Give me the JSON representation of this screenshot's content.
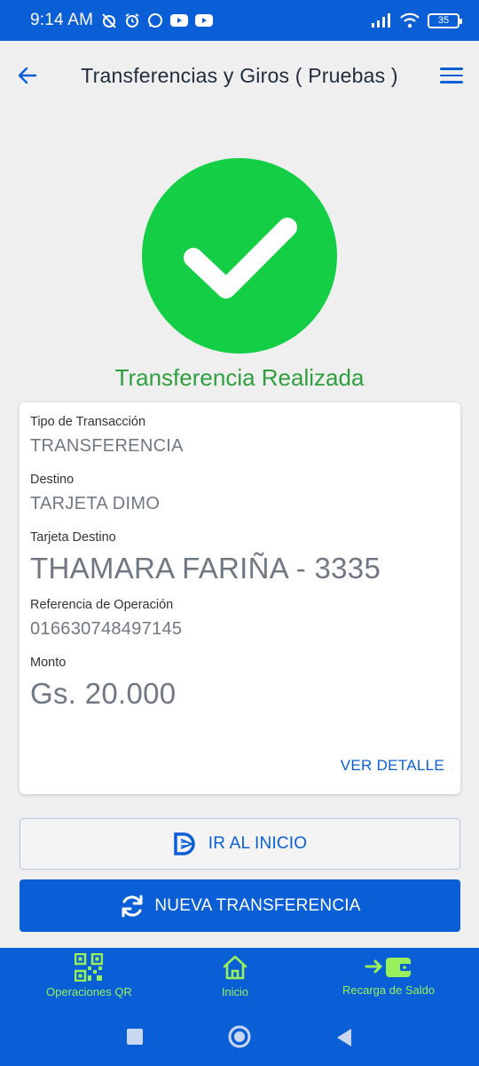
{
  "status_bar": {
    "time": "9:14 AM",
    "battery": "35"
  },
  "header": {
    "title": "Transferencias y Giros ( Pruebas )"
  },
  "result": {
    "title": "Transferencia Realizada"
  },
  "details": {
    "tipo_label": "Tipo de Transacción",
    "tipo_value": "TRANSFERENCIA",
    "destino_label": "Destino",
    "destino_value": "TARJETA DIMO",
    "tarjeta_label": "Tarjeta Destino",
    "tarjeta_value": "THAMARA FARIÑA - 3335",
    "referencia_label": "Referencia de Operación",
    "referencia_value": "016630748497145",
    "monto_label": "Monto",
    "monto_value": "Gs. 20.000",
    "ver_detalle": "VER DETALLE"
  },
  "buttons": {
    "home_label": "IR AL INICIO",
    "new_label": "NUEVA TRANSFERENCIA"
  },
  "bottom_nav": {
    "items": [
      {
        "label": "Operaciones QR",
        "icon": "qr-code-icon"
      },
      {
        "label": "Inicio",
        "icon": "home-icon"
      },
      {
        "label": "Recarga de Saldo",
        "icon": "wallet-recharge-icon"
      }
    ]
  },
  "colors": {
    "primary": "#0a5fd6",
    "success": "#14cf45",
    "success_text": "#2f9e3f",
    "nav_accent": "#98f05a"
  }
}
